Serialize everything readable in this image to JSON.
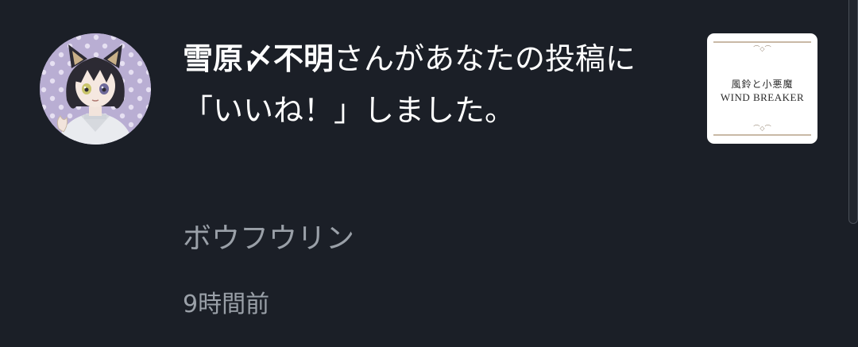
{
  "notification": {
    "username": "雪原〆不明",
    "message_suffix": "さんがあなたの投稿に「いいね！」しました。",
    "post_title": "ボウフウリン",
    "timestamp": "9時間前",
    "thumbnail": {
      "title_jp": "風鈴と小悪魔",
      "title_en": "WIND BREAKER",
      "ornament": "⌒◇⌒"
    },
    "avatar_icon": "user-avatar-cat-ears",
    "colors": {
      "background": "#1b1f27",
      "primary_text": "#ffffff",
      "secondary_text": "#9aa0a8",
      "avatar_bg": "#b9aed3"
    }
  }
}
